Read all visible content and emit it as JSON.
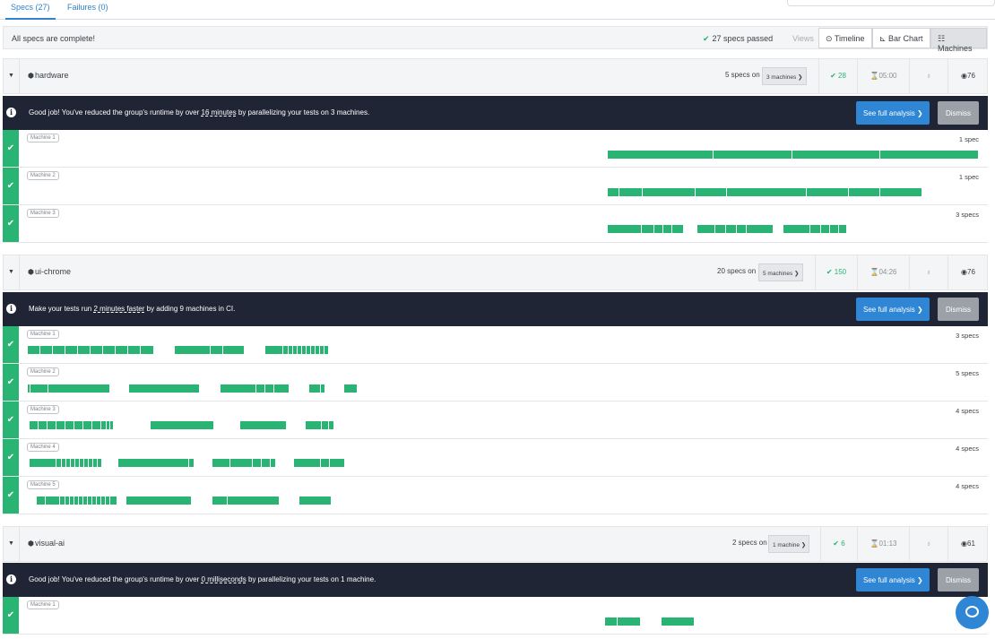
{
  "tabs": [
    {
      "label": "Specs (27)"
    },
    {
      "label": "Failures (0)"
    }
  ],
  "status": {
    "message": "All specs are complete!",
    "passed": "27 specs passed",
    "views_label": "Views",
    "views": [
      "Timeline",
      "Bar Chart",
      "Machines"
    ],
    "active_view": "Machines"
  },
  "groups": [
    {
      "name": "hardware",
      "specs_on": "5 specs on",
      "machines_select": "3 machines",
      "passed": "28",
      "duration": "05:00",
      "browser": "76",
      "banner": {
        "pre": "Good job! You've reduced the group's runtime by over ",
        "em": "16 minutes",
        "post": " by parallelizing your tests on 3 machines."
      },
      "full_analysis": "See full analysis",
      "dismiss": "Dismiss",
      "machines": [
        {
          "label": "Machine 1",
          "specs": "1 spec"
        },
        {
          "label": "Machine 2",
          "specs": "1 spec"
        },
        {
          "label": "Machine 3",
          "specs": "3 specs"
        }
      ]
    },
    {
      "name": "ui-chrome",
      "specs_on": "20 specs on",
      "machines_select": "5 machines",
      "passed": "150",
      "duration": "04:26",
      "browser": "76",
      "banner": {
        "pre": "Make your tests run ",
        "em": "2 minutes faster",
        "post": " by adding 9 machines in CI."
      },
      "full_analysis": "See full analysis",
      "dismiss": "Dismiss",
      "machines": [
        {
          "label": "Machine 1",
          "specs": "3 specs"
        },
        {
          "label": "Machine 2",
          "specs": "5 specs"
        },
        {
          "label": "Machine 3",
          "specs": "4 specs"
        },
        {
          "label": "Machine 4",
          "specs": "4 specs"
        },
        {
          "label": "Machine 5",
          "specs": "4 specs"
        }
      ]
    },
    {
      "name": "visual-ai",
      "specs_on": "2 specs on",
      "machines_select": "1 machine",
      "passed": "6",
      "duration": "01:13",
      "browser": "61",
      "banner": {
        "pre": "Good job! You've reduced the group's runtime by over ",
        "em": "0 milliseconds",
        "post": " by parallelizing your tests on 1 machine."
      },
      "full_analysis": "See full analysis",
      "dismiss": "Dismiss",
      "machines": [
        {
          "label": "Machine 1",
          "specs": ""
        }
      ]
    }
  ],
  "colors": {
    "pass": "#29b474",
    "banner": "#1f2535",
    "accent": "#2e86d4"
  },
  "icons": [
    "check-icon",
    "caret-down-icon",
    "cube-icon",
    "info-icon",
    "hourglass-icon",
    "linux-icon",
    "chrome-icon",
    "clock-icon",
    "bar-chart-icon",
    "list-icon",
    "chat-icon"
  ]
}
